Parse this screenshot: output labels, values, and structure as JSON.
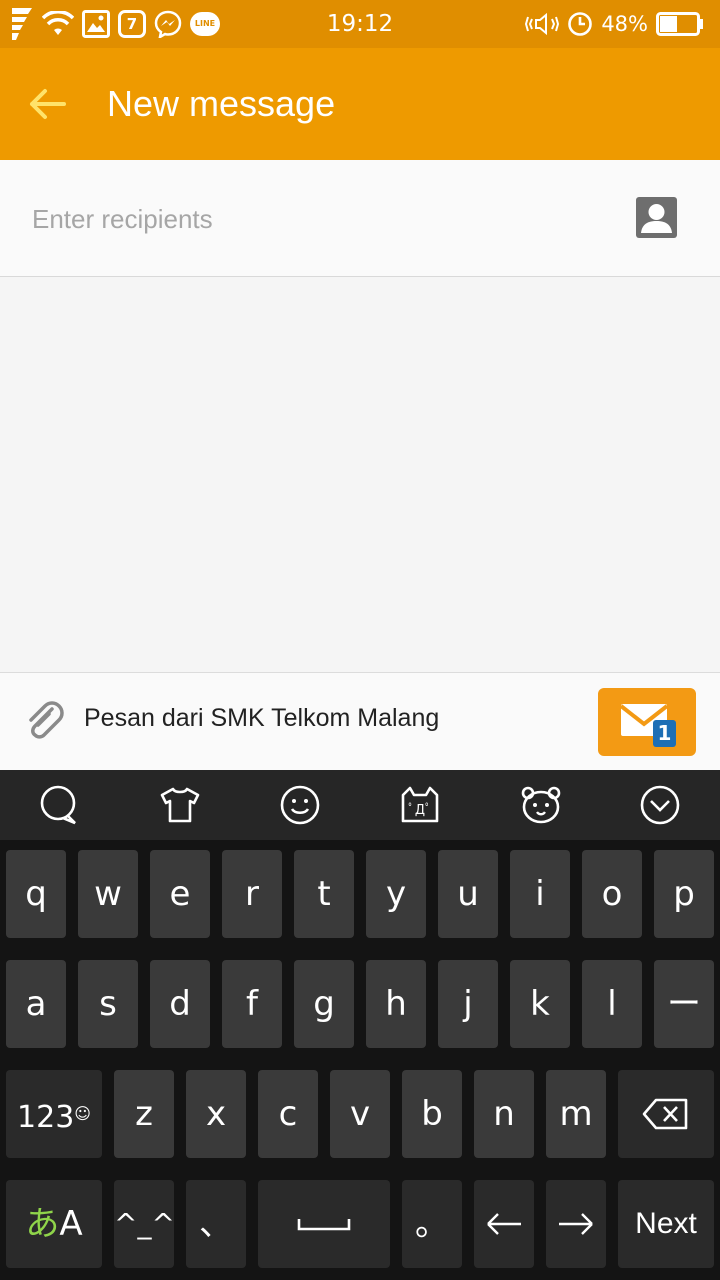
{
  "status_bar": {
    "time": "19:12",
    "notification_count": "7",
    "line_badge": "LINE",
    "battery_percent": "48%",
    "battery_level": 0.48
  },
  "app_bar": {
    "title": "New message"
  },
  "recipients": {
    "placeholder": "Enter recipients"
  },
  "compose": {
    "message_text": "Pesan dari SMK Telkom Malang",
    "sim_badge": "1"
  },
  "keyboard": {
    "toolbar_icons": [
      "speech-bubble-icon",
      "tshirt-icon",
      "smiley-icon",
      "cat-kaomoji-icon",
      "bear-icon",
      "collapse-icon"
    ],
    "row1": [
      "q",
      "w",
      "e",
      "r",
      "t",
      "y",
      "u",
      "i",
      "o",
      "p"
    ],
    "row2": [
      "a",
      "s",
      "d",
      "f",
      "g",
      "h",
      "j",
      "k",
      "l",
      "ー"
    ],
    "row3_mode": "123",
    "row3": [
      "z",
      "x",
      "c",
      "v",
      "b",
      "n",
      "m"
    ],
    "row4": {
      "kana": "あ",
      "latin": "A",
      "kaomoji": "^_^",
      "comma": "、",
      "period": "。",
      "next": "Next"
    }
  },
  "colors": {
    "status_bar": "#e08e00",
    "app_bar": "#ee9a00",
    "send_button": "#f39a14",
    "keyboard_bg": "#141414",
    "key_bg": "#3a3a3a"
  }
}
